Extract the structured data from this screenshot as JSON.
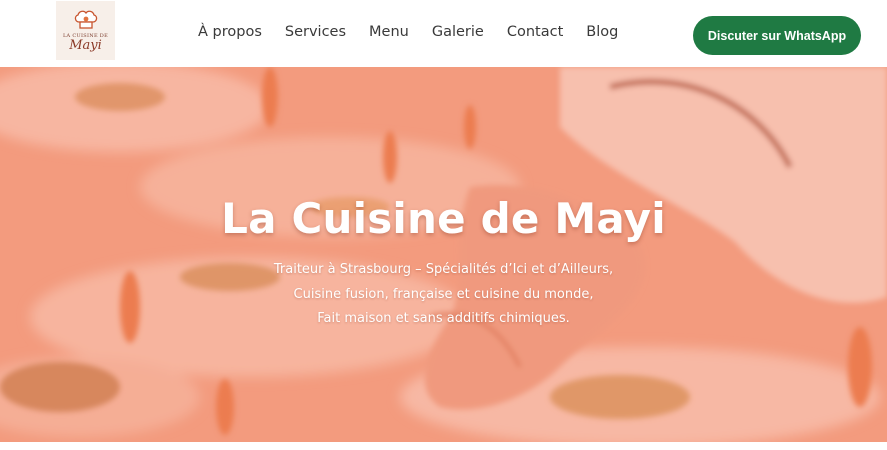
{
  "header": {
    "logo": {
      "top_text": "LA CUISINE DE",
      "brand": "Mayi",
      "icon": "chef-hat-icon"
    },
    "nav": [
      {
        "label": "À propos"
      },
      {
        "label": "Services"
      },
      {
        "label": "Menu"
      },
      {
        "label": "Galerie"
      },
      {
        "label": "Contact"
      },
      {
        "label": "Blog"
      }
    ],
    "cta_label": "Discuter sur WhatsApp"
  },
  "hero": {
    "title": "La Cuisine de Mayi",
    "subtitle_lines": [
      "Traiteur à Strasbourg – Spécialités d’Ici et d’Ailleurs,",
      "Cuisine fusion, française et cuisine du monde,",
      "Fait maison et sans additifs chimiques."
    ]
  },
  "colors": {
    "cta_bg": "#1f7a43",
    "hero_tint": "#f2a587",
    "nav_text": "#3a3a3a",
    "brand_text": "#8b3a28"
  }
}
